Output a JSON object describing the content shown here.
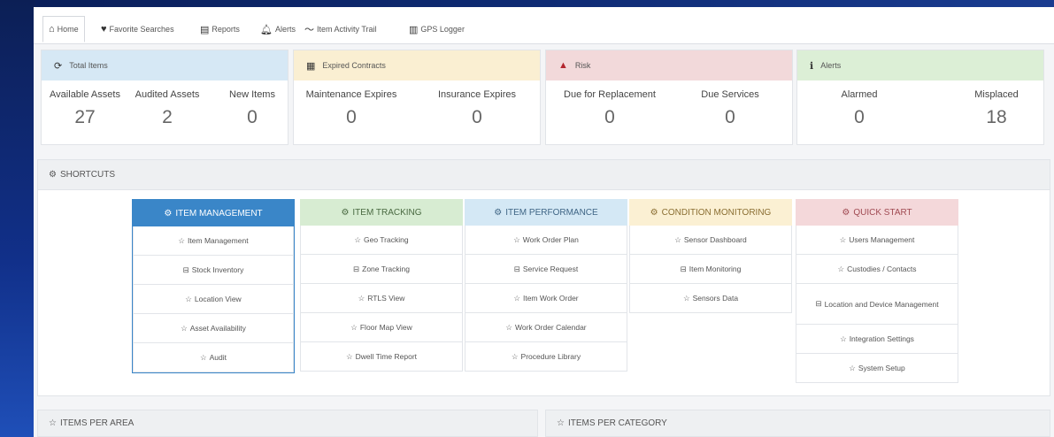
{
  "nav": {
    "tabs": [
      {
        "label": "Home",
        "icon": "home-icon"
      },
      {
        "label": "Favorite Searches",
        "icon": "heart-icon"
      },
      {
        "label": "Reports",
        "icon": "reports-icon"
      },
      {
        "label": "Alerts",
        "icon": "bell-icon"
      },
      {
        "label": "Item Activity Trail",
        "icon": "trend-icon"
      },
      {
        "label": "GPS Logger",
        "icon": "columns-icon"
      }
    ]
  },
  "cards": {
    "total_items": {
      "title": "Total Items",
      "color": "#d6e8f5",
      "stats": [
        {
          "label": "Available Assets",
          "value": "27"
        },
        {
          "label": "Audited Assets",
          "value": "2"
        },
        {
          "label": "New Items",
          "value": "0"
        }
      ]
    },
    "expired_contracts": {
      "title": "Expired Contracts",
      "color": "#faefd2",
      "stats": [
        {
          "label": "Maintenance Expires",
          "value": "0"
        },
        {
          "label": "Insurance Expires",
          "value": "0"
        }
      ]
    },
    "risk": {
      "title": "Risk",
      "color": "#f2d9da",
      "stats": [
        {
          "label": "Due for Replacement",
          "value": "0"
        },
        {
          "label": "Due Services",
          "value": "0"
        }
      ]
    },
    "alerts": {
      "title": "Alerts",
      "color": "#dcefd6",
      "stats": [
        {
          "label": "Alarmed",
          "value": "0"
        },
        {
          "label": "Misplaced",
          "value": "18"
        }
      ]
    }
  },
  "shortcuts": {
    "title": "SHORTCUTS",
    "columns": [
      {
        "title": "ITEM MANAGEMENT",
        "head_bg": "#3a86c8",
        "head_fg": "#ffffff",
        "items": [
          {
            "label": "Item Management",
            "icon": "star-icon"
          },
          {
            "label": "Stock Inventory",
            "icon": "box-icon"
          },
          {
            "label": "Location View",
            "icon": "star-icon"
          },
          {
            "label": "Asset Availability",
            "icon": "star-icon"
          },
          {
            "label": "Audit",
            "icon": "star-icon"
          }
        ]
      },
      {
        "title": "ITEM TRACKING",
        "head_bg": "#d7ecd2",
        "head_fg": "#4a6a42",
        "items": [
          {
            "label": "Geo Tracking",
            "icon": "star-icon"
          },
          {
            "label": "Zone Tracking",
            "icon": "box-icon"
          },
          {
            "label": "RTLS View",
            "icon": "star-icon"
          },
          {
            "label": "Floor Map View",
            "icon": "star-icon"
          },
          {
            "label": "Dwell Time Report",
            "icon": "star-icon"
          }
        ]
      },
      {
        "title": "ITEM PERFORMANCE",
        "head_bg": "#d4e8f5",
        "head_fg": "#3f6585",
        "items": [
          {
            "label": "Work Order Plan",
            "icon": "star-icon"
          },
          {
            "label": "Service Request",
            "icon": "box-icon"
          },
          {
            "label": "Item Work Order",
            "icon": "star-icon"
          },
          {
            "label": "Work Order Calendar",
            "icon": "star-icon"
          },
          {
            "label": "Procedure Library",
            "icon": "star-icon"
          }
        ]
      },
      {
        "title": "CONDITION MONITORING",
        "head_bg": "#fbf0d3",
        "head_fg": "#8a6e32",
        "items": [
          {
            "label": "Sensor Dashboard",
            "icon": "star-icon"
          },
          {
            "label": "Item Monitoring",
            "icon": "box-icon"
          },
          {
            "label": "Sensors Data",
            "icon": "star-icon"
          }
        ]
      },
      {
        "title": "QUICK START",
        "head_bg": "#f4d8da",
        "head_fg": "#a04a52",
        "items": [
          {
            "label": "Users Management",
            "icon": "star-icon"
          },
          {
            "label": "Custodies / Contacts",
            "icon": "star-icon"
          },
          {
            "label": "Location and Device Management",
            "icon": "box-icon"
          },
          {
            "label": "Integration Settings",
            "icon": "star-icon"
          },
          {
            "label": "System Setup",
            "icon": "star-icon"
          }
        ]
      }
    ]
  },
  "panels": {
    "items_per_area": "ITEMS PER AREA",
    "items_per_category": "ITEMS PER CATEGORY"
  }
}
